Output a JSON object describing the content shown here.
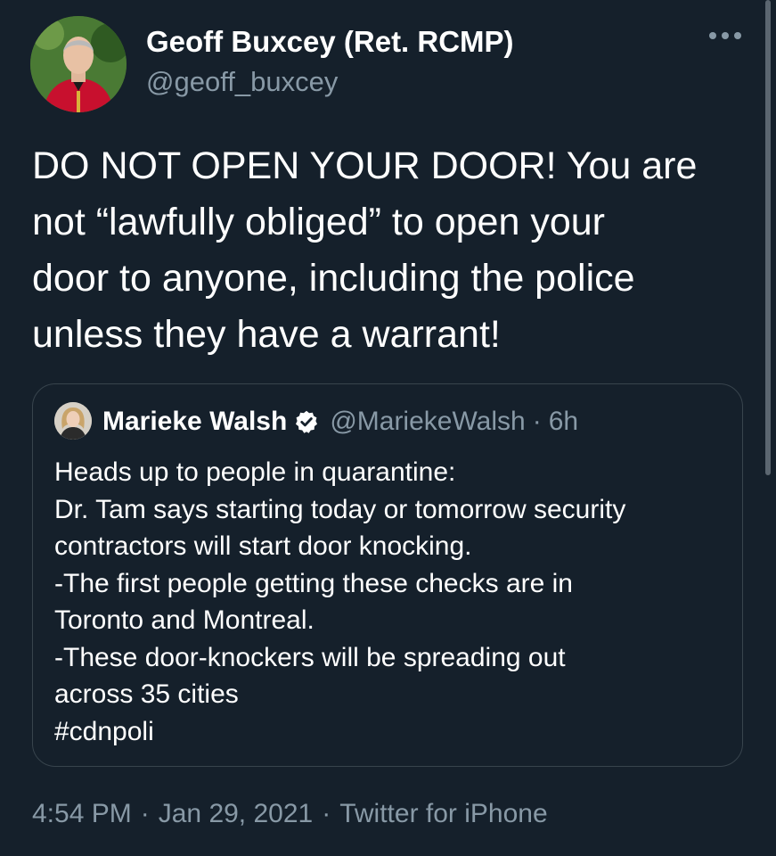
{
  "tweet": {
    "author_name": "Geoff Buxcey (Ret. RCMP)",
    "author_handle": "@geoff_buxcey",
    "text_lines": [
      "DO NOT OPEN YOUR DOOR! You are",
      "not “lawfully obliged” to open your",
      "door to anyone, including the police",
      "unless they have a warrant!"
    ],
    "timestamp_time": "4:54 PM",
    "timestamp_date": "Jan 29, 2021",
    "source": "Twitter for iPhone",
    "separator": "·"
  },
  "quoted_tweet": {
    "author_name": "Marieke Walsh",
    "author_handle": "@MariekeWalsh",
    "separator": "·",
    "age": "6h",
    "text_lines": [
      "Heads up to people in quarantine:",
      "Dr. Tam says starting today or tomorrow security",
      "contractors will start door knocking.",
      "-The first people getting these checks are in",
      "Toronto and Montreal.",
      "-These door-knockers will be spreading out",
      "across 35 cities",
      "#cdnpoli"
    ]
  },
  "icons": {
    "more": "more-horizontal-icon",
    "verified": "verified-badge-icon"
  },
  "colors": {
    "background": "#15202b",
    "primary_text": "#ffffff",
    "secondary_text": "#8899a6",
    "border": "#38444d"
  }
}
